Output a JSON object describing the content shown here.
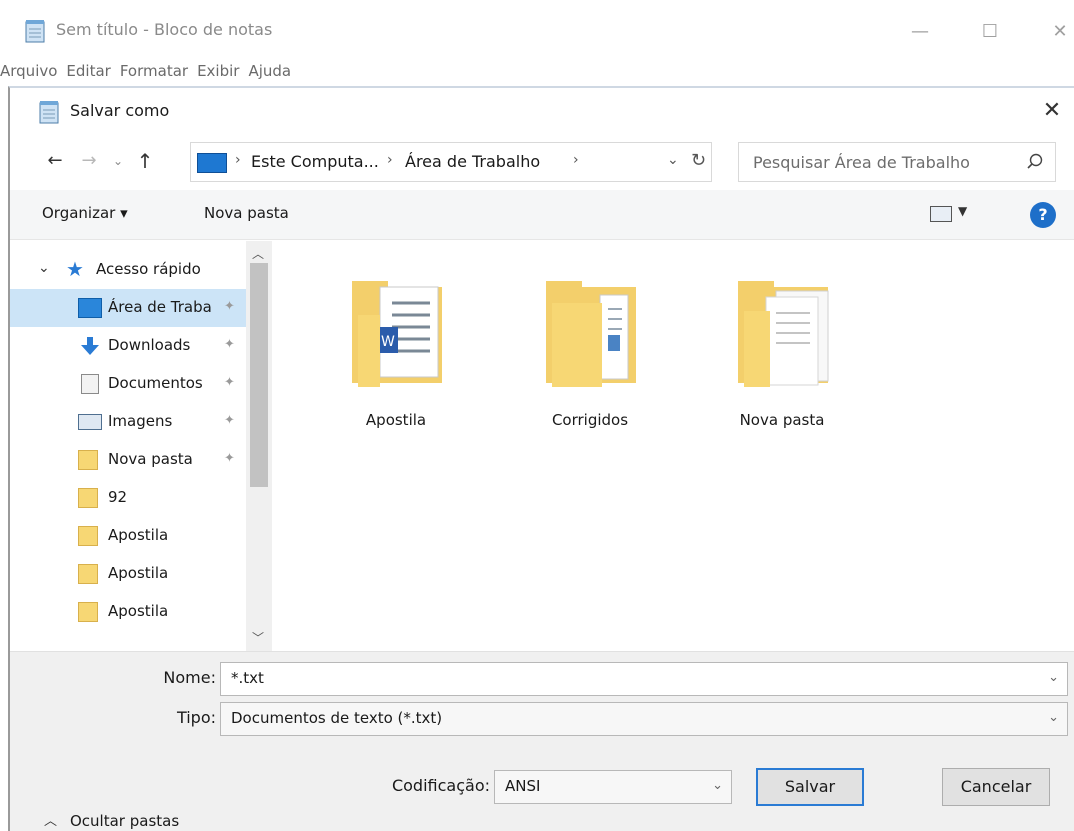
{
  "notepad": {
    "title": "Sem título - Bloco de notas",
    "window_controls": {
      "minimize": "—",
      "maximize": "☐",
      "close": "✕"
    },
    "menu": [
      "Arquivo",
      "Editar",
      "Formatar",
      "Exibir",
      "Ajuda"
    ]
  },
  "dialog": {
    "title": "Salvar como",
    "close": "✕",
    "address": {
      "segments": [
        "Este Computa...",
        "Área de Trabalho"
      ],
      "separator": "›",
      "search_placeholder": "Pesquisar Área de Trabalho"
    },
    "toolbar": {
      "organize": "Organizar ▾",
      "new_folder": "Nova pasta",
      "help": "?"
    },
    "nav": {
      "quick_access": "Acesso rápido",
      "items": [
        {
          "label": "Área de Traba",
          "icon": "desktop-icon",
          "pinned": true,
          "selected": true
        },
        {
          "label": "Downloads",
          "icon": "download-icon",
          "pinned": true,
          "selected": false
        },
        {
          "label": "Documentos",
          "icon": "document-icon",
          "pinned": true,
          "selected": false
        },
        {
          "label": "Imagens",
          "icon": "image-icon",
          "pinned": true,
          "selected": false
        },
        {
          "label": "Nova pasta",
          "icon": "folder-icon",
          "pinned": true,
          "selected": false
        },
        {
          "label": "92",
          "icon": "folder-icon",
          "pinned": false,
          "selected": false
        },
        {
          "label": "Apostila",
          "icon": "folder-icon",
          "pinned": false,
          "selected": false
        },
        {
          "label": "Apostila",
          "icon": "folder-icon",
          "pinned": false,
          "selected": false
        },
        {
          "label": "Apostila",
          "icon": "folder-icon",
          "pinned": false,
          "selected": false
        }
      ]
    },
    "files": [
      {
        "name": "Apostila",
        "icon": "folder-word-icon"
      },
      {
        "name": "Corrigidos",
        "icon": "folder-documents-icon"
      },
      {
        "name": "Nova pasta",
        "icon": "folder-pages-icon"
      }
    ],
    "fields": {
      "name_label": "Nome:",
      "name_value": "*.txt",
      "type_label": "Tipo:",
      "type_value": "Documentos de texto (*.txt)",
      "encoding_label": "Codificação:",
      "encoding_value": "ANSI"
    },
    "buttons": {
      "save": "Salvar",
      "cancel": "Cancelar",
      "hide_folders": "Ocultar pastas"
    },
    "colors": {
      "accent": "#2a7bd4",
      "selection": "#cce4f7",
      "folder": "#f7d774"
    }
  }
}
